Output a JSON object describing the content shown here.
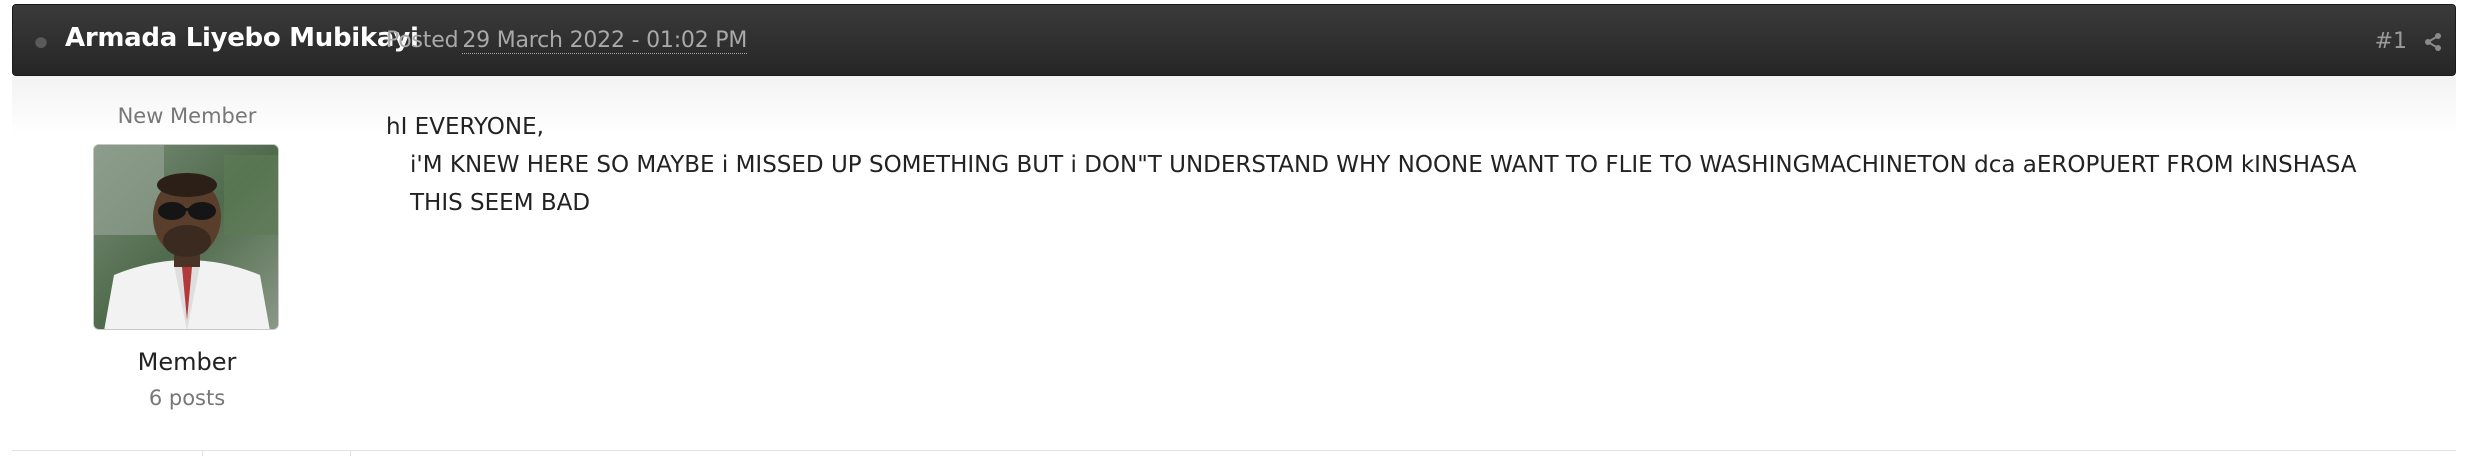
{
  "post": {
    "author": "Armada Liyebo Mubikayi",
    "posted_label": "Posted",
    "posted_date": "29 March 2022 - 01:02 PM",
    "post_number": "#1"
  },
  "author_info": {
    "title": "New Member",
    "group": "Member",
    "post_count": "6 posts"
  },
  "content": {
    "line1": "hI EVERYONE,",
    "line2": "i'M KNEW HERE SO MAYBE i MISSED UP SOMETHING BUT i DON\"T UNDERSTAND WHY NOONE WANT TO FLIE TO WASHINGMACHINETON dca aEROPUERT FROM kINSHASA THIS SEEM BAD"
  },
  "icons": {
    "online": "online-status-dot-icon",
    "share": "share-icon"
  },
  "colors": {
    "header_bg": "#2e2e2e",
    "author_text": "#ffffff",
    "muted_text": "#a9a9a9"
  }
}
